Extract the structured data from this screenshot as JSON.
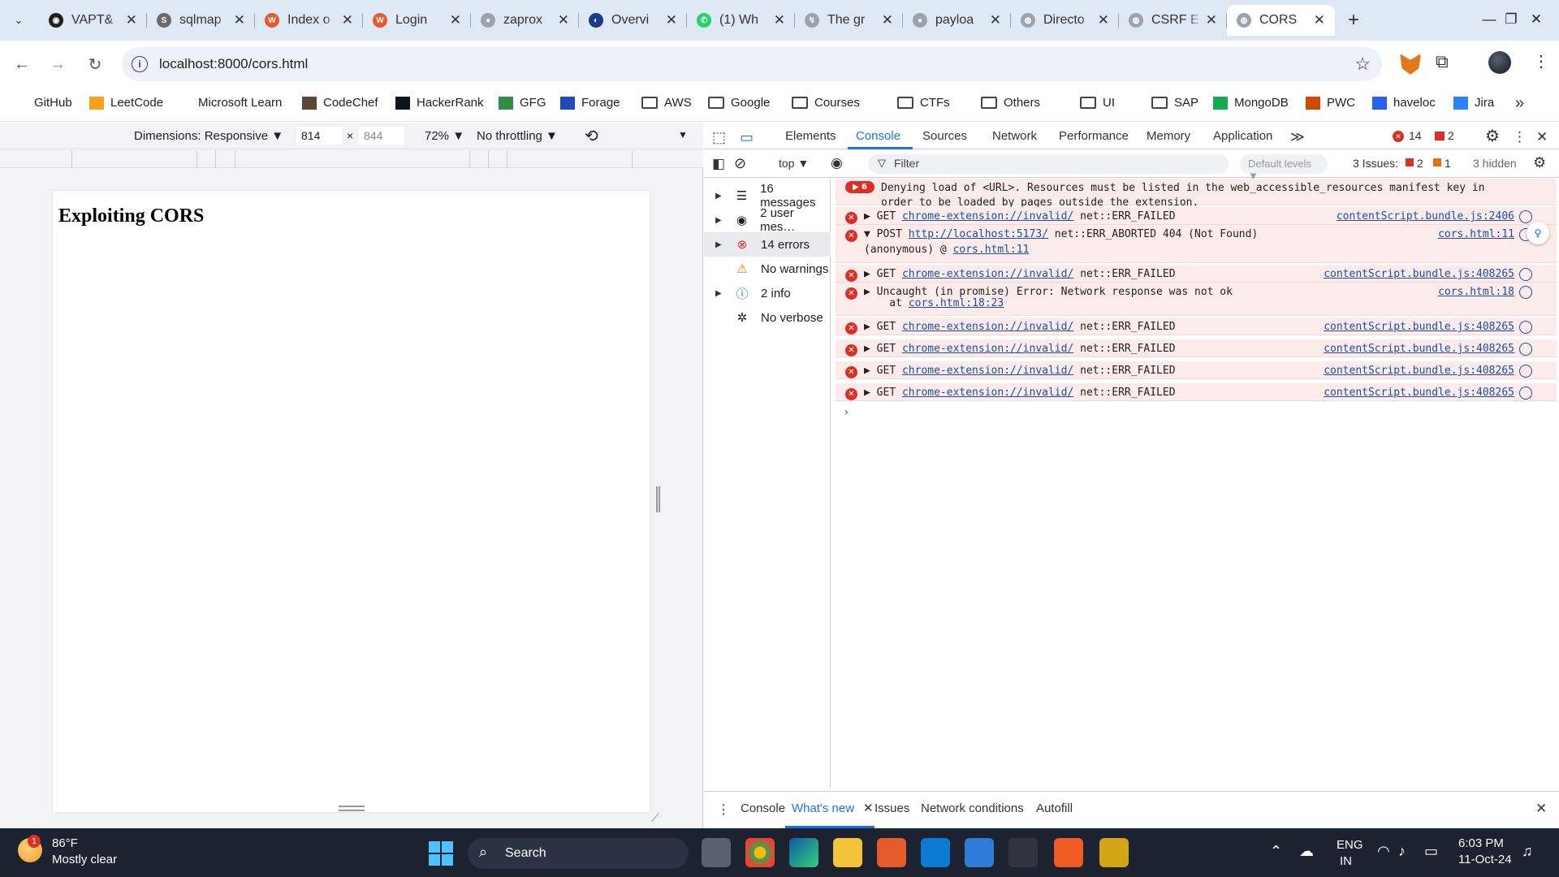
{
  "tabs": [
    {
      "title": "VAPT&",
      "fav": "#1f1f1f",
      "glyph": "◉"
    },
    {
      "title": "sqlmap",
      "fav": "#6b6b6b",
      "glyph": "S"
    },
    {
      "title": "Index o",
      "fav": "#e65a2b",
      "glyph": "W"
    },
    {
      "title": "Login",
      "fav": "#e65a2b",
      "glyph": "W"
    },
    {
      "title": "zaprox",
      "fav": "#9aa4ad",
      "glyph": "●"
    },
    {
      "title": "Overvi",
      "fav": "#1b3a8c",
      "glyph": "◐"
    },
    {
      "title": "(1) Wh",
      "fav": "#25d366",
      "glyph": "✆"
    },
    {
      "title": "The gr",
      "fav": "#9aa4ad",
      "glyph": "↯"
    },
    {
      "title": "payloa",
      "fav": "#9aa4ad",
      "glyph": "●"
    },
    {
      "title": "Directo",
      "fav": "#9aa4ad",
      "glyph": "◍"
    },
    {
      "title": "CSRF E",
      "fav": "#9aa4ad",
      "glyph": "◍"
    },
    {
      "title": "CORS",
      "fav": "#9aa4ad",
      "glyph": "◍"
    }
  ],
  "omnibox": {
    "url": "localhost:8000/cors.html"
  },
  "bookmarks": [
    {
      "label": "GitHub",
      "type": "none",
      "color": ""
    },
    {
      "label": "LeetCode",
      "type": "icon",
      "color": "#f89f1b"
    },
    {
      "label": "Microsoft Learn",
      "type": "ms",
      "color": ""
    },
    {
      "label": "CodeChef",
      "type": "icon",
      "color": "#5b4638"
    },
    {
      "label": "HackerRank",
      "type": "icon",
      "color": "#0e141e"
    },
    {
      "label": "GFG",
      "type": "icon",
      "color": "#2f8d46"
    },
    {
      "label": "Forage",
      "type": "icon",
      "color": "#1d4bb8"
    },
    {
      "label": "AWS",
      "type": "folder",
      "color": ""
    },
    {
      "label": "Google",
      "type": "folder",
      "color": ""
    },
    {
      "label": "Courses",
      "type": "folder",
      "color": ""
    },
    {
      "label": "CTFs",
      "type": "folder",
      "color": ""
    },
    {
      "label": "Others",
      "type": "folder",
      "color": ""
    },
    {
      "label": "UI",
      "type": "folder",
      "color": ""
    },
    {
      "label": "SAP",
      "type": "folder",
      "color": ""
    },
    {
      "label": "MongoDB",
      "type": "icon",
      "color": "#13aa52"
    },
    {
      "label": "PWC",
      "type": "icon",
      "color": "#d04a02"
    },
    {
      "label": "haveloc",
      "type": "icon",
      "color": "#2563eb"
    },
    {
      "label": "Jira",
      "type": "icon",
      "color": "#2684ff"
    }
  ],
  "device": {
    "dimensions": "Dimensions: Responsive ▼",
    "width": "814",
    "height": "844",
    "zoom": "72% ▼",
    "throttle": "No throttling ▼"
  },
  "page": {
    "heading": "Exploiting CORS"
  },
  "devtools": {
    "tabs": [
      "Elements",
      "Console",
      "Sources",
      "Network",
      "Performance",
      "Memory",
      "Application"
    ],
    "error_count": "14",
    "issue_count": "2",
    "context": "top ▼",
    "filter_placeholder": "Filter",
    "levels": "Default levels ▼",
    "issues_label": "3 Issues:",
    "issues_err": "2",
    "issues_warn": "1",
    "hidden": "3 hidden",
    "sidebar": [
      {
        "label": "16 messages",
        "icon": "☰",
        "tri": "▶"
      },
      {
        "label": "2 user mes…",
        "icon": "◉",
        "tri": "▶"
      },
      {
        "label": "14 errors",
        "icon": "⊗",
        "tri": "▶"
      },
      {
        "label": "No warnings",
        "icon": "⚠",
        "tri": ""
      },
      {
        "label": "2 info",
        "icon": "ⓘ",
        "tri": "▶"
      },
      {
        "label": "No verbose",
        "icon": "✲",
        "tri": ""
      }
    ]
  },
  "console": {
    "group_count": "6",
    "group_text": "Denying load of <URL>. Resources must be listed in the web_accessible_resources manifest key in\norder to be loaded by pages outside the extension.",
    "rows": [
      {
        "method": "▶ GET",
        "link": "chrome-extension://invalid/",
        "rest": " net::ERR_FAILED",
        "src": "contentScript.bundle.js:2406"
      },
      {
        "method": "▼ POST",
        "link": "http://localhost:5173/",
        "rest": " net::ERR_ABORTED 404 (Not Found)",
        "src": "cors.html:11",
        "sub_pre": "(anonymous) @ ",
        "sub_link": "cors.html:11"
      },
      {
        "method": "▶ GET",
        "link": "chrome-extension://invalid/",
        "rest": " net::ERR_FAILED",
        "src": "contentScript.bundle.js:408265"
      },
      {
        "method": "▶ Uncaught (in promise) Error: Network response was not ok",
        "link": "",
        "rest": "",
        "src": "cors.html:18",
        "sub_pre": "    at ",
        "sub_link": "cors.html:18:23"
      },
      {
        "method": "▶ GET",
        "link": "chrome-extension://invalid/",
        "rest": " net::ERR_FAILED",
        "src": "contentScript.bundle.js:408265"
      },
      {
        "method": "▶ GET",
        "link": "chrome-extension://invalid/",
        "rest": " net::ERR_FAILED",
        "src": "contentScript.bundle.js:408265"
      },
      {
        "method": "▶ GET",
        "link": "chrome-extension://invalid/",
        "rest": " net::ERR_FAILED",
        "src": "contentScript.bundle.js:408265"
      },
      {
        "method": "▶ GET",
        "link": "chrome-extension://invalid/",
        "rest": " net::ERR_FAILED",
        "src": "contentScript.bundle.js:408265"
      }
    ],
    "prompt": "›"
  },
  "drawer": {
    "tabs": [
      "Console",
      "What's new",
      "Issues",
      "Network conditions",
      "Autofill"
    ],
    "active": "What's new"
  },
  "taskbar": {
    "weather_temp": "86°F",
    "weather_desc": "Mostly clear",
    "weather_badge": "1",
    "search": "Search",
    "lang": "ENG",
    "region": "IN",
    "time": "6:03 PM",
    "date": "11-Oct-24"
  }
}
